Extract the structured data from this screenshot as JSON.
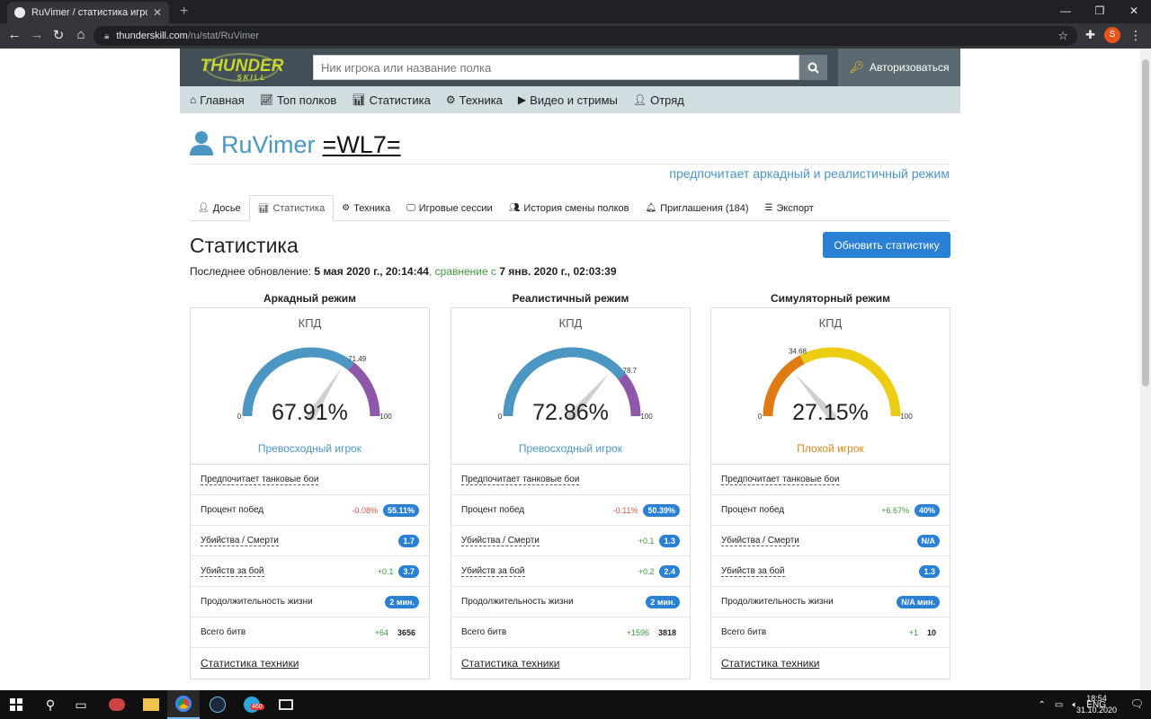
{
  "browser": {
    "tab_title": "RuVimer / статистика игрока в W",
    "url_host": "thunderskill.com",
    "url_path": "/ru/stat/RuVimer",
    "profile_initial": "S"
  },
  "site": {
    "logo_text_top": "THUNDER",
    "logo_text_bottom": "SKILL",
    "search_placeholder": "Ник игрока или название полка",
    "login_label": "Авторизоваться",
    "nav": [
      "Главная",
      "Топ полков",
      "Статистика",
      "Техника",
      "Видео и стримы",
      "Отряд"
    ]
  },
  "profile": {
    "name": "RuVimer",
    "clan": "=WL7=",
    "prefers": "предпочитает аркадный и реалистичный режим",
    "tabs": [
      "Досье",
      "Статистика",
      "Техника",
      "Игровые сессии",
      "История смены полков",
      "Приглашения (184)",
      "Экспорт"
    ]
  },
  "stats": {
    "heading": "Статистика",
    "refresh_label": "Обновить статистику",
    "updated_prefix": "Последнее обновление:",
    "updated_date": "5 мая 2020 г., 20:14:44",
    "compare_prefix": "сравнение",
    "compare_from": "с",
    "compare_date": "7 янв. 2020 г., 02:03:39"
  },
  "modes": [
    {
      "title": "Аркадный режим",
      "kpd_label": "КПД",
      "value": 67.91,
      "percent": "67.91%",
      "top_marker": 71.49,
      "top_marker_label": "71.49",
      "min_label": "0",
      "max_label": "100",
      "rank": "Превосходный игрок",
      "rank_color": "#4c96c3",
      "arc_main": "#4c96c3",
      "arc_top": "#8e57aa",
      "rows": [
        {
          "label": "Предпочитает танковые бои",
          "dashed": true,
          "diff": "",
          "value": "",
          "badge": false
        },
        {
          "label": "Процент побед",
          "dashed": false,
          "diff": "-0.08%",
          "diff_type": "neg",
          "value": "55.11%",
          "badge": true
        },
        {
          "label": "Убийства / Смерти",
          "dashed": true,
          "diff": "",
          "value": "1.7",
          "badge": true
        },
        {
          "label": "Убийств за бой",
          "dashed": true,
          "diff": "+0.1",
          "diff_type": "pos",
          "value": "3.7",
          "badge": true
        },
        {
          "label": "Продолжительность жизни",
          "dashed": false,
          "diff": "",
          "value": "2 мин.",
          "badge": true
        },
        {
          "label": "Всего битв",
          "dashed": false,
          "diff": "+64",
          "diff_type": "pos",
          "value": "3656",
          "badge": false
        }
      ],
      "vehicle_link": "Статистика техники"
    },
    {
      "title": "Реалистичный режим",
      "kpd_label": "КПД",
      "value": 72.86,
      "percent": "72.86%",
      "top_marker": 78.7,
      "top_marker_label": "78.7",
      "min_label": "0",
      "max_label": "100",
      "rank": "Превосходный игрок",
      "rank_color": "#4c96c3",
      "arc_main": "#4c96c3",
      "arc_top": "#8e57aa",
      "rows": [
        {
          "label": "Предпочитает танковые бои",
          "dashed": true,
          "diff": "",
          "value": "",
          "badge": false
        },
        {
          "label": "Процент побед",
          "dashed": false,
          "diff": "-0.11%",
          "diff_type": "neg",
          "value": "50.39%",
          "badge": true
        },
        {
          "label": "Убийства / Смерти",
          "dashed": true,
          "diff": "+0.1",
          "diff_type": "pos",
          "value": "1.3",
          "badge": true
        },
        {
          "label": "Убийств за бой",
          "dashed": true,
          "diff": "+0.2",
          "diff_type": "pos",
          "value": "2.4",
          "badge": true
        },
        {
          "label": "Продолжительность жизни",
          "dashed": false,
          "diff": "",
          "value": "2 мин.",
          "badge": true
        },
        {
          "label": "Всего битв",
          "dashed": false,
          "diff": "+1596",
          "diff_type": "pos",
          "value": "3818",
          "badge": false
        }
      ],
      "vehicle_link": "Статистика техники"
    },
    {
      "title": "Симуляторный режим",
      "kpd_label": "КПД",
      "value": 27.15,
      "percent": "27.15%",
      "top_marker": 34.68,
      "top_marker_label": "34.68",
      "min_label": "0",
      "max_label": "100",
      "rank": "Плохой игрок",
      "rank_color": "#e0861a",
      "arc_main": "#e07b12",
      "arc_top": "#eccd12",
      "rows": [
        {
          "label": "Предпочитает танковые бои",
          "dashed": true,
          "diff": "",
          "value": "",
          "badge": false
        },
        {
          "label": "Процент побед",
          "dashed": false,
          "diff": "+6.67%",
          "diff_type": "pos",
          "value": "40%",
          "badge": true
        },
        {
          "label": "Убийства / Смерти",
          "dashed": true,
          "diff": "",
          "value": "N/A",
          "badge": true
        },
        {
          "label": "Убийств за бой",
          "dashed": true,
          "diff": "",
          "value": "1.3",
          "badge": true
        },
        {
          "label": "Продолжительность жизни",
          "dashed": false,
          "diff": "",
          "value": "N/A мин.",
          "badge": true
        },
        {
          "label": "Всего битв",
          "dashed": false,
          "diff": "+1",
          "diff_type": "pos",
          "value": "10",
          "badge": false
        }
      ],
      "vehicle_link": "Статистика техники"
    }
  ],
  "taskbar": {
    "lang": "ENG",
    "time": "18:54",
    "date": "31.10.2020",
    "telegram_badge": "460"
  }
}
